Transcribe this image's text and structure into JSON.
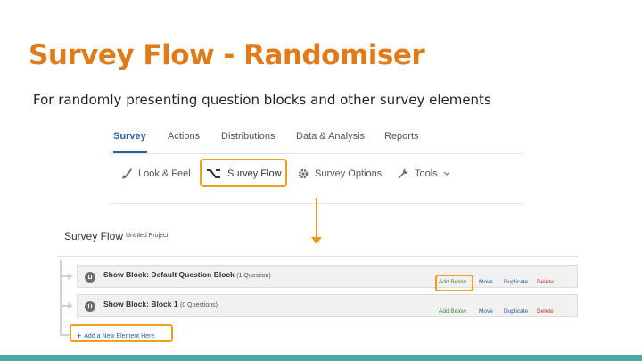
{
  "slide": {
    "title": "Survey Flow - Randomiser",
    "subtitle": "For randomly presenting question blocks and other survey elements"
  },
  "nav_tabs": [
    "Survey",
    "Actions",
    "Distributions",
    "Data & Analysis",
    "Reports"
  ],
  "toolbar": {
    "look_feel": "Look & Feel",
    "survey_flow": "Survey Flow",
    "survey_options": "Survey Options",
    "tools": "Tools"
  },
  "survey_flow": {
    "title": "Survey Flow",
    "project": "Untitled Project",
    "blocks": [
      {
        "label": "Show Block: Default Question Block",
        "count": "(1 Question)"
      },
      {
        "label": "Show Block: Block 1",
        "count": "(0 Questions)"
      }
    ],
    "actions": {
      "add_below": "Add Below",
      "move": "Move",
      "duplicate": "Duplicate",
      "delete": "Delete"
    },
    "add_new": "Add a New Element Here"
  },
  "colors": {
    "title": "#e07b1a",
    "highlight": "#f0a020",
    "active_tab": "#2b5f9e",
    "add_below": "#3e8e3e",
    "delete": "#c0392b",
    "bottom_bar": "#4aa9a6"
  }
}
